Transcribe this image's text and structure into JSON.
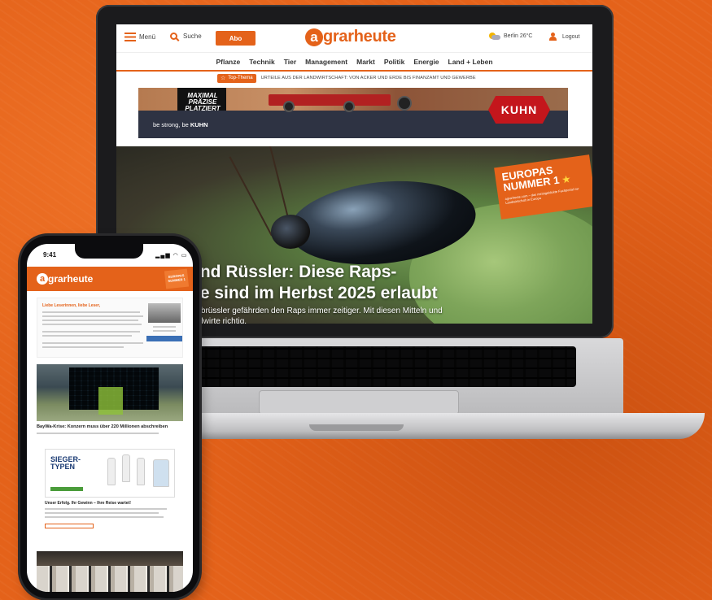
{
  "laptop": {
    "header": {
      "menu_label": "Menü",
      "search_label": "Suche",
      "abo_label": "Abo",
      "logo_mark": "a",
      "logo_text": "grarheute",
      "weather": "Berlin 26°C",
      "logout_label": "Logout"
    },
    "nav": [
      "Pflanze",
      "Technik",
      "Tier",
      "Management",
      "Markt",
      "Politik",
      "Energie",
      "Land + Leben"
    ],
    "topthema": {
      "badge": "Top-Thema",
      "text": "URTEILE AUS DER LANDWIRTSCHAFT: VON ACKER UND ERDE BIS FINANZAMT UND GEWERBE"
    },
    "ad": {
      "slogan_top": "MAXIMAL PRÄZISE PLATZIERT",
      "claim_prefix": "be strong, be",
      "claim_brand": "KUHN",
      "brand_logo": "KUHN"
    },
    "hero": {
      "title_line1": "und Rüssler: Diese Raps-",
      "title_line2": "de sind im Herbst 2025 erlaubt",
      "subtitle_line1": "triebrüssler gefährden den Raps immer zeitiger. Mit diesen Mitteln und",
      "subtitle_line2": "andwirte richtig."
    },
    "europas_badge": {
      "title_line1": "EUROPAS",
      "title_line2": "NUMMER 1",
      "star": "★",
      "sub": "agrarheute.com – das meistgeklickte Fachportal zur Landwirtschaft in Europa"
    }
  },
  "phone": {
    "time": "9:41",
    "status_icons": "▂▄▆ ◠ ▭",
    "logo_mark": "a",
    "logo_text": "grarheute",
    "badge": "EUROPAS NUMMER 1",
    "greeting_title": "Liebe Leserinnen, liebe Leser,",
    "article1_caption": "BayWa-Krise: Konzern muss über 220 Millionen abschreiben",
    "ad_title_line1": "SIEGER-",
    "ad_title_line2": "TYPEN",
    "article2_caption": "Unser Erfolg. Ihr Gewinn – Ihre Reise wartet!"
  },
  "colors": {
    "brand_orange": "#e4621a",
    "kuhn_red": "#c4161c",
    "ad_navy": "#2e3343"
  }
}
